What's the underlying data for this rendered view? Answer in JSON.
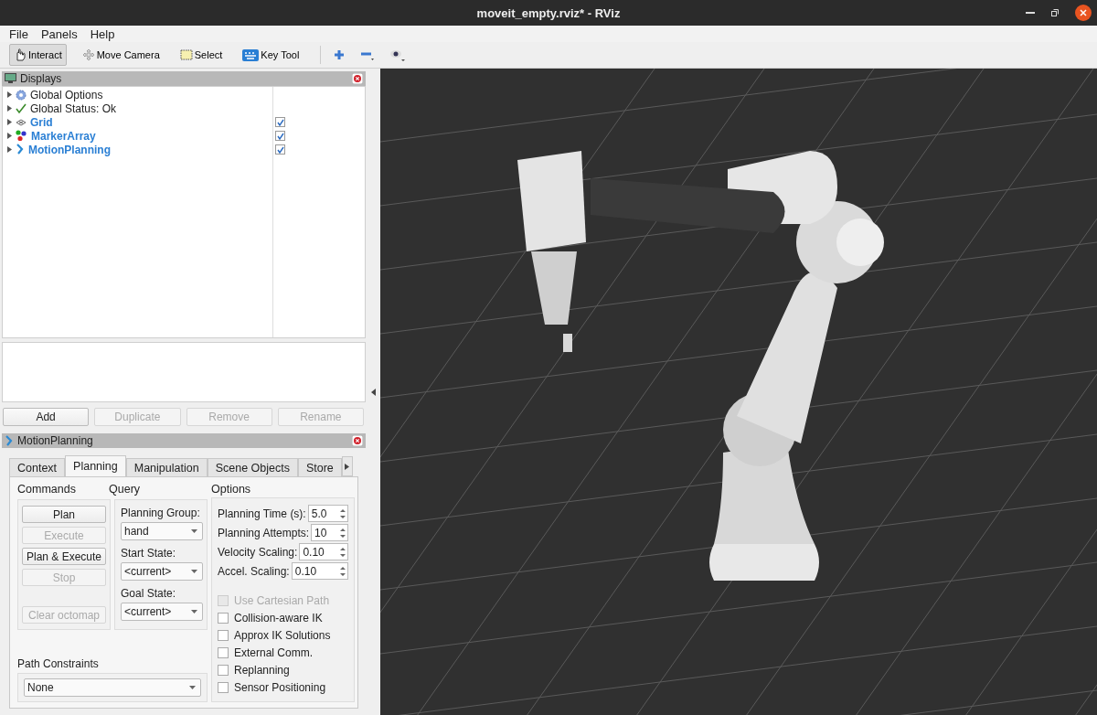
{
  "window": {
    "title": "moveit_empty.rviz* - RViz"
  },
  "menu": [
    {
      "label": "File"
    },
    {
      "label": "Panels"
    },
    {
      "label": "Help"
    }
  ],
  "toolbar": [
    {
      "label": "Interact",
      "kind": "interact",
      "selected": true
    },
    {
      "label": "Move Camera",
      "kind": "camera",
      "selected": false
    },
    {
      "label": "Select",
      "kind": "select",
      "selected": false
    },
    {
      "label": "Key Tool",
      "kind": "keyboard",
      "selected": false
    }
  ],
  "displays": {
    "title": "Displays",
    "globals": [
      {
        "label": "Global Options",
        "kind": "options"
      },
      {
        "label": "Global Status: Ok",
        "kind": "status"
      }
    ],
    "items": [
      {
        "label": "Grid",
        "kind": "grid",
        "checked": true
      },
      {
        "label": "MarkerArray",
        "kind": "markers",
        "checked": true
      },
      {
        "label": "MotionPlanning",
        "kind": "planning",
        "checked": true
      }
    ],
    "buttons": [
      {
        "label": "Add",
        "disabled": false
      },
      {
        "label": "Duplicate",
        "disabled": true
      },
      {
        "label": "Remove",
        "disabled": true
      },
      {
        "label": "Rename",
        "disabled": true
      }
    ]
  },
  "motion_planning": {
    "title": "MotionPlanning",
    "tabs": [
      {
        "label": "Context",
        "selected": false
      },
      {
        "label": "Planning",
        "selected": true
      },
      {
        "label": "Manipulation",
        "selected": false
      },
      {
        "label": "Scene Objects",
        "selected": false
      },
      {
        "label": "Store",
        "selected": false
      }
    ],
    "commands": {
      "title": "Commands",
      "buttons": [
        {
          "label": "Plan",
          "disabled": false
        },
        {
          "label": "Execute",
          "disabled": true
        },
        {
          "label": "Plan & Execute",
          "disabled": false
        },
        {
          "label": "Stop",
          "disabled": true
        },
        {
          "label": "Clear octomap",
          "disabled": true
        }
      ]
    },
    "query": {
      "title": "Query",
      "fields": [
        {
          "label": "Planning Group:",
          "value": "hand"
        },
        {
          "label": "Start State:",
          "value": "<current>"
        },
        {
          "label": "Goal State:",
          "value": "<current>"
        }
      ]
    },
    "options": {
      "title": "Options",
      "spinboxes": [
        {
          "label": "Planning Time (s):",
          "value": "5.0"
        },
        {
          "label": "Planning Attempts:",
          "value": "10"
        },
        {
          "label": "Velocity Scaling:",
          "value": "0.10"
        },
        {
          "label": "Accel. Scaling:",
          "value": "0.10"
        }
      ],
      "checkboxes": [
        {
          "label": "Use Cartesian Path",
          "checked": false,
          "disabled": true
        },
        {
          "label": "Collision-aware IK",
          "checked": false,
          "disabled": false
        },
        {
          "label": "Approx IK Solutions",
          "checked": false,
          "disabled": false
        },
        {
          "label": "External Comm.",
          "checked": false,
          "disabled": false
        },
        {
          "label": "Replanning",
          "checked": false,
          "disabled": false
        },
        {
          "label": "Sensor Positioning",
          "checked": false,
          "disabled": false
        }
      ]
    },
    "path_constraints": {
      "label": "Path Constraints",
      "value": "None"
    }
  }
}
